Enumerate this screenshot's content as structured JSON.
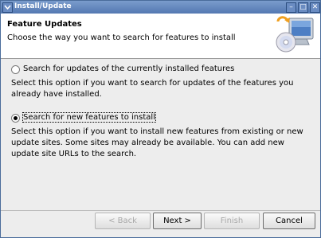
{
  "window": {
    "title": "Install/Update",
    "minimize_glyph": "–",
    "maximize_glyph": "□",
    "close_glyph": "✕"
  },
  "header": {
    "title": "Feature Updates",
    "description": "Choose the way you want to search for features to install",
    "icon": "install-update-monitor-icon"
  },
  "options": [
    {
      "label": "Search for updates of the currently installed features",
      "selected": false,
      "description": "Select this option if you want to search for updates of the features you already have installed."
    },
    {
      "label": "Search for new features to install",
      "selected": true,
      "description": "Select this option if you want to install new features from existing or new update sites. Some sites may already be available. You can add new update site URLs to the search."
    }
  ],
  "buttons": {
    "back": {
      "label": "< Back",
      "enabled": false
    },
    "next": {
      "label": "Next >",
      "enabled": true
    },
    "finish": {
      "label": "Finish",
      "enabled": false
    },
    "cancel": {
      "label": "Cancel",
      "enabled": true
    }
  },
  "colors": {
    "titlebar": "#5478b2",
    "accent": "#4a6c9b"
  }
}
